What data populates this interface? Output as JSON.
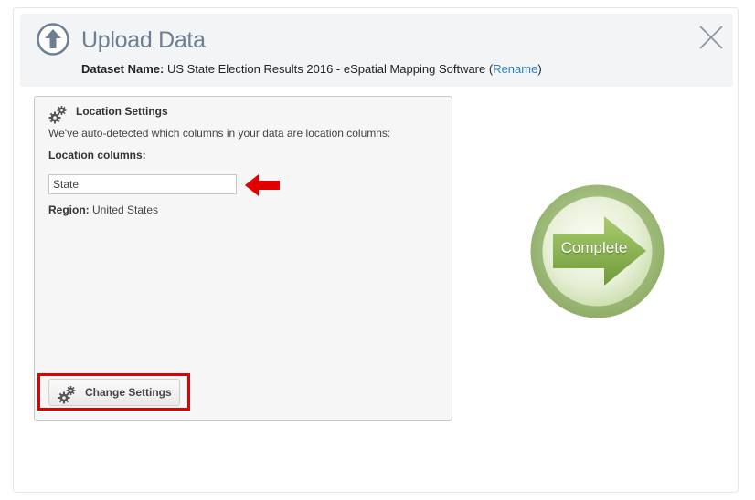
{
  "header": {
    "title": "Upload Data",
    "dataset_label": "Dataset Name:",
    "dataset_value": " US State Election Results 2016 - eSpatial Mapping Software (",
    "rename_link": "Rename",
    "dataset_suffix": ")",
    "icons": {
      "upload": "upload-arrow-icon",
      "close": "close-icon"
    }
  },
  "settings": {
    "title": "Location Settings",
    "description": "We've auto-detected which columns in your data are location columns:",
    "location_columns_label": "Location columns:",
    "location_columns_value": "State",
    "region_label": "Region:",
    "region_value": " United States",
    "change_button_label": "Change Settings",
    "icons": {
      "settings": "gears-icon"
    }
  },
  "complete": {
    "label": "Complete"
  },
  "colors": {
    "title": "#6c7f93",
    "link": "#2f7fbf",
    "annotation_red": "#e00000",
    "complete_green": "#8fb06a"
  }
}
